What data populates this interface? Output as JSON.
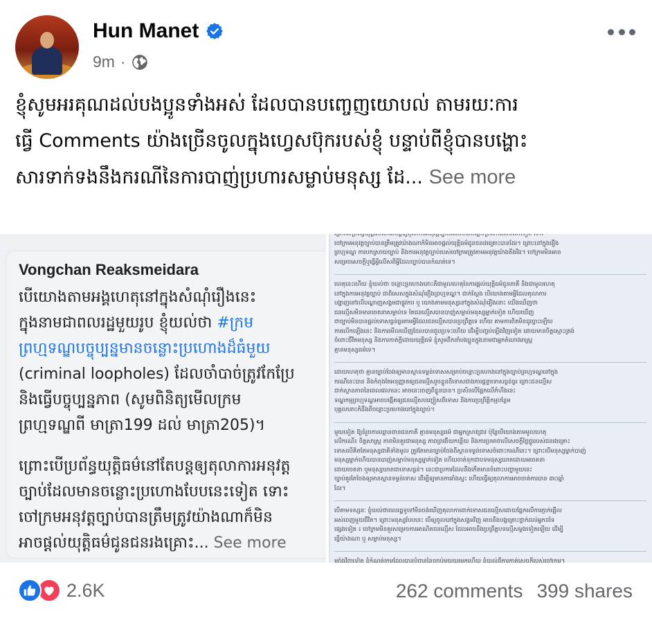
{
  "post": {
    "author": "Hun Manet",
    "time": "9m",
    "separator": "·",
    "text_lines": [
      "ខ្ញុំសូមអរគុណដល់បងប្អូនទាំងអស់ ដែលបានបញ្ចេញយោបល់ តាមរយៈការ",
      "ធ្វើ Comments យ៉ាងច្រើនចូលក្នុងហ្វេសប៊ុករបស់ខ្ញុំ បន្ទាប់ពីខ្ញុំបានបង្ហោះ",
      "សារទាក់ទងនឹងករណីនៃការបាញ់ប្រហារសម្លាប់មនុស្ស ដែ..."
    ],
    "see_more": "See more"
  },
  "left_image": {
    "author": "Vongchan Reaksmeidara",
    "para1_lines": [
      "បើយោងតាមអង្គហេតុនៅក្នុងសំណុំរឿងនេះ",
      "ក្នុងនាមជាពលរដ្ឋមួយរូប ខ្ញុំយល់ថា ",
      "ព្រហ្មទណ្ឌបច្ចុប្បន្នមានចន្លោះប្រហោងដ៏ធំមួយ",
      "(criminal loopholes) ដែលចាំបាច់ត្រូវកែប្រែ",
      "និងធ្វើបច្ចុប្បន្នភាព (សូមពិនិត្យមើលក្រម",
      "ព្រហ្មទណ្ឌពី មាត្រា199 ដល់ មាត្រា205)។"
    ],
    "hashtag": "#ក្រម",
    "para2_lines": [
      "ព្រោះបើប្រព័ន្ធយុត្តិធម៌នៅតែបន្តឲ្យតុលាការអនុវត្ត",
      "ច្បាប់ដែលមានចន្លោះប្រហោងបែបនេះទៀត ទោះ",
      "ចៅក្រមអនុវត្តច្បាប់បានត្រឹមត្រូវយ៉ាងណាក៏មិន",
      "អាចផ្តល់យុត្តិធម៌ជូនជនរងគ្រោះ... "
    ],
    "see_more": "See more"
  },
  "right_image": {
    "paragraphs": [
      [
        "ព្រោះបើប្រព័ន្ធយុត្តិធម៌នៅតែបន្តឲ្យតុលាការអនុវត្តច្បាប់ដែលមានចន្លោះប្រហោងបែបនេះទៀត ទោះ",
        "ចៅក្រមអនុវត្តច្បាប់បានត្រឹមត្រូវយ៉ាងណាក៏មិនអាចផ្តល់យុត្តិធម៌ជូនជនរងគ្រោះបានដែរ។ ព្រោះនៅក្នុងរឿង",
        "ព្រហ្មទណ្ឌ ការបកស្រាយច្បាប់ និងការអនុវត្តច្បាប់របស់ចៅក្រមត្រូវតាមអនុវត្តយ៉ាងតឹងរឹង។ ចៅក្រមមិនអាច",
        "សម្រេចសេចក្តីឬធ្វើអ្វីលើសពីអ្វីដែលច្បាប់បានកំណត់ទេ។"
      ],
      [
        "ហេតុនេះហើយ ខ្ញុំយល់ថា ចន្លោះប្រហោងនោះគឺជាមូលហេតុនៃការផ្តល់យុត្តិធម៌ជូនភាគី និងជាមូលហេតុ",
        "នៅក្នុងការអនុវត្តច្បាប់ ជាពិសេសក្នុងសំណុំរឿងព្រហ្មទណ្ឌ។ ជាក់ស្តែង បើយោងតាមអ្វីដែលតុលាការ",
        "បង្ហាញនៅលើបណ្តាញសង្គមជាផ្លូវការ ឬ យោងតាមមនុស្សនៅក្នុងសំណុំរឿងនោះ យើងឃើញថា",
        "ជនល្មើសមិនមានចេតនាសម្លាប់ទេ តែជនល្មើសបានបាញ់សម្លាប់មនុស្សម្នាក់ទៀត ហើយឃើញ",
        "ថាច្បាប់មិនបានផ្តល់ទោសធ្ងន់ធ្ងរតាមអ្វីដែលជនល្មើសបានប្រព្រឹត្តទេ ហើយ តាមការពិតមិនដូច្នោះឡើយ",
        "ការលើកឡើងនេះ និងការមើលឃើញដែលបានជួបប្រទះហើយ ដើម្បីបញ្ចប់ឡើងវិញទៀត ដោយមានចិត្តស្មោះត្រង់",
        "ចំពោះជីវិតមនុស្ស និងការកាត់ក្តីដោយយុត្តិធម៌ ខ្ញុំសូមដឹកនាំបងប្អូនក្នុងនាមជាអ្នកតំណាងរាស្ត្រ",
        "គ្មានមនុស្សធម៌ទេ។"
      ],
      [
        "ដោយហេតុថា គ្មានច្បាប់ចែងឲ្យមានស្ថានទម្ងន់ទោសសម្រាប់ចន្លោះប្រហោងនៅក្នុងច្បាប់ព្រហ្មទណ្ឌនៅក្នុង",
        "ករណីនេះបាន និងកំពុងតែអនុញ្ញាតឲ្យជនល្មើសរួចខ្លួនពីទោសជាងការផ្តន្ទាទោសធ្ងន់ធ្ងរ ព្រោះជនល្មើស",
        "ដាក់ស្ថានភាពនៃពេលវេលានេះ អាចនេះចេញពីខ្លួនបាន។ ប្រសិនបើផ្អែកលើកំហឹងនេះ",
        "ទណ្ឌកម្មព្រហ្មទណ្ឌអាចបង្កើតឲ្យជនល្មើសបញ្ចៀសពីទោស និងការប្រព្រឹត្តិកម្មបន្ថែម",
        "បុគ្គលនោះក៏ដឹងពីចន្លោះប្រហោងនៅក្នុងច្បាប់។"
      ],
      [
        "មួយទៀត ឱ្យធំរួចការឈ្លានពានជនភាគី គ្មានមនុស្សធម៌ ជាអ្នកស្រាវជ្រាវ ប៉ុន្តែបើយោងតាមមូលហេតុ",
        "លើករណី៖ ចិត្តសាស្ត្រ ភាពមិនគួរជាមនុស្ស ភាពព្រងើយកន្តើយ និងការប្រមាថលើសេចក្តីថ្លៃថ្នូររបស់ជនរងគ្រោះ",
        "ទោសបើគិតតែមនុស្សជាតិទាំងមូល ត្រូវតែមានច្បាប់ចែងពីស្ថានទម្ងន់ទោសចំពោះករណីនេះ។ ព្រោះបើមនុស្សម្នាក់បាញ់",
        "មនុស្សម្នាក់ហើយបានបាញ់សម្លាប់មនុស្សម្នាក់ទៀត ហើយចាត់ទុកជាបទមនុស្សឃាតដោយអចេតនា",
        "ដោយចេតនា ឬមនុស្សឃាតជាទោសធ្ងន់។ នេះជាប្រការដែលនឹងកើតមានចំពោះបញ្ហាមួយនេះ",
        "ច្បាប់គួរតែចែងឲ្យមានស្ថានទម្ងន់ទោស ដើម្បីឲ្យមានការរាំងស្ទះ ហើយធ្វើឲ្យតុលាការអាចចាត់ការបាន ៣០ឆ្នាំ",
        "ដែរ។"
      ],
      [
        "បើតាមទស្សនៈ ខ្ញុំយល់ថាពលរដ្ឋទូទៅមិនចង់ឃើញតុលាការដាក់ទោសជនល្មើសដោយផ្អែកលើការភ្ញាក់ផ្អើល",
        "អស់ពេញមួយជីវិត។ ព្រោះមនុស្សបែបនេះ បើឲ្យចូលនៅក្នុងសង្គមវិញ អាចនឹងបង្កគ្រោះថ្នាក់ដល់អ្នកដទៃ",
        "ផ្សេងទៀត ៖ ចៅក្រមមិនគួរសម្រេចការអាណិតជនល្មើស ដែលអាចនឹងប្រព្រឹត្តបទល្មើសម្តងទៀតឡើយ ដើម្បី",
        "ធ្វើយ៉ាងណា ឬ សម្លាប់មនុស្ស។"
      ],
      [
        "ម្យ៉ាងវិញទៀត ខ្ញុំកំណត់ក្រមដែលបានបំពាននៃច្បាប់មួយយូរមកហើយ ខ្ញុំយល់ពីការកាត់សេចក្តីរបស់ចៅក្រម។"
      ]
    ]
  },
  "footer": {
    "reaction_count": "2.6K",
    "comments": "262 comments",
    "shares": "399 shares"
  },
  "colors": {
    "accent": "#1b74e4",
    "love": "#f33e58",
    "secondary_text": "#65676b"
  },
  "icons": [
    "verified-badge-icon",
    "globe-icon",
    "more-options-icon",
    "like-icon",
    "love-icon"
  ]
}
